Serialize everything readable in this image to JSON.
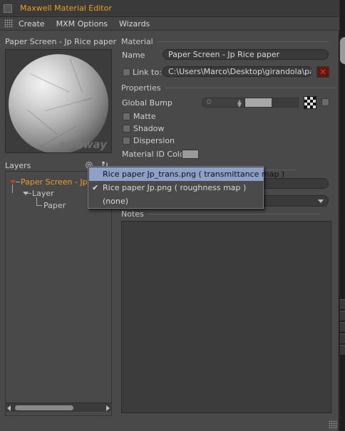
{
  "window": {
    "title": "Maxwell Material Editor"
  },
  "menu": [
    "Create",
    "MXM Options",
    "Wizards"
  ],
  "preview": {
    "label": "Paper Screen - Jp Rice paper",
    "watermark": "arroway"
  },
  "layers": {
    "label": "Layers",
    "tree": [
      {
        "label": "Paper Screen - Jp R",
        "level": 0,
        "color": "#e8a020"
      },
      {
        "label": "Layer",
        "level": 1,
        "color": "#c8c8c8"
      },
      {
        "label": "Paper",
        "level": 2,
        "color": "#c8c8c8"
      }
    ]
  },
  "material": {
    "heading": "Material",
    "name_label": "Name",
    "name_value": "Paper Screen - Jp Rice paper",
    "link_label": "Link to:",
    "link_value": "C:\\Users\\Marco\\Desktop\\girandola\\pape"
  },
  "properties": {
    "heading": "Properties",
    "global_bump_label": "Global Bump",
    "global_bump_value": "0",
    "matte_label": "Matte",
    "shadow_label": "Shadow",
    "dispersion_label": "Dispersion",
    "material_id_label": "Material ID Color",
    "material_id_color": "#9a9a9a"
  },
  "notes": {
    "heading": "Notes"
  },
  "popup": {
    "items": [
      {
        "label": "Rice paper Jp_trans.png ( transmittance map )",
        "checked": false,
        "highlighted": true
      },
      {
        "label": "Rice paper Jp.png ( roughness map )",
        "checked": true,
        "highlighted": false
      },
      {
        "label": "(none)",
        "checked": false,
        "highlighted": false
      }
    ]
  },
  "colors": {
    "accent": "#e8a020",
    "highlight": "#8fa0c8",
    "panel": "#494949",
    "remove": "#ff2a1a"
  }
}
